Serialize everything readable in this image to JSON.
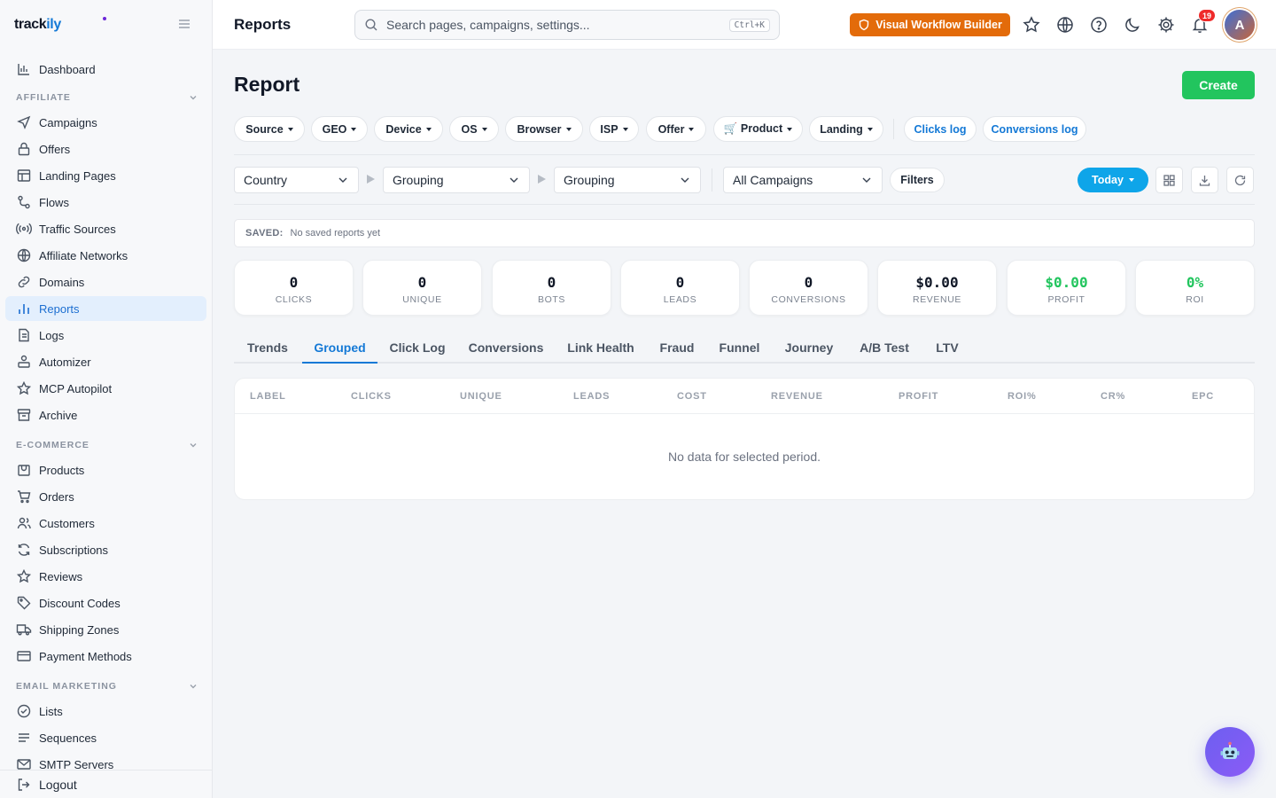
{
  "app": {
    "logo_left": "track",
    "logo_right": "ily"
  },
  "sidebar": {
    "dashboard": "Dashboard",
    "sections": [
      {
        "label": "AFFILIATE",
        "items": [
          "Campaigns",
          "Offers",
          "Landing Pages",
          "Flows",
          "Traffic Sources",
          "Affiliate Networks",
          "Domains",
          "Reports",
          "Logs",
          "Automizer",
          "MCP Autopilot",
          "Archive"
        ]
      },
      {
        "label": "E-COMMERCE",
        "items": [
          "Products",
          "Orders",
          "Customers",
          "Subscriptions",
          "Reviews",
          "Discount Codes",
          "Shipping Zones",
          "Payment Methods"
        ]
      },
      {
        "label": "EMAIL MARKETING",
        "items": [
          "Lists",
          "Sequences",
          "SMTP Servers"
        ]
      }
    ],
    "active_item": "Reports",
    "logout": "Logout"
  },
  "topbar": {
    "title": "Reports",
    "search_placeholder": "Search pages, campaigns, settings...",
    "search_shortcut": "Ctrl+K",
    "workflow_button": "Visual Workflow Builder",
    "notifications_count": "19",
    "avatar_initial": "A"
  },
  "page": {
    "heading": "Report",
    "create_button": "Create",
    "filter_chips": [
      "Source",
      "GEO",
      "Device",
      "OS",
      "Browser",
      "ISP",
      "Offer",
      "🛒 Product",
      "Landing"
    ],
    "log_links": [
      "Clicks log",
      "Conversions log"
    ],
    "group_selects": [
      "Country",
      "Grouping",
      "Grouping"
    ],
    "campaign_select": "All Campaigns",
    "filters_button": "Filters",
    "date_button": "Today",
    "saved_label": "SAVED:",
    "saved_text": "No saved reports yet",
    "stats": [
      {
        "value": "0",
        "label": "CLICKS"
      },
      {
        "value": "0",
        "label": "UNIQUE"
      },
      {
        "value": "0",
        "label": "BOTS"
      },
      {
        "value": "0",
        "label": "LEADS"
      },
      {
        "value": "0",
        "label": "CONVERSIONS"
      },
      {
        "value": "$0.00",
        "label": "REVENUE"
      },
      {
        "value": "$0.00",
        "label": "PROFIT"
      },
      {
        "value": "0%",
        "label": "ROI"
      }
    ],
    "tabs": [
      "Trends",
      "Grouped",
      "Click Log",
      "Conversions",
      "Link Health",
      "Fraud",
      "Funnel",
      "Journey",
      "A/B Test",
      "LTV"
    ],
    "active_tab": "Grouped",
    "table": {
      "columns": [
        "LABEL",
        "CLICKS",
        "UNIQUE",
        "LEADS",
        "COST",
        "REVENUE",
        "PROFIT",
        "ROI%",
        "CR%",
        "EPC"
      ],
      "empty_text": "No data for selected period."
    }
  },
  "colors": {
    "accent": "#1479d6",
    "create": "#22c55e",
    "workflow": "#e36b0a",
    "today": "#0ea5e9",
    "profit": "#22c55e",
    "badge": "#ef2a2a"
  },
  "icons": {
    "topbar": [
      "search-icon",
      "shield-icon",
      "star-icon",
      "globe-icon",
      "help-icon",
      "moon-icon",
      "gear-icon",
      "bell-icon"
    ],
    "toolbar": [
      "grid-icon",
      "download-icon",
      "refresh-icon"
    ],
    "fab": "robot-icon"
  }
}
